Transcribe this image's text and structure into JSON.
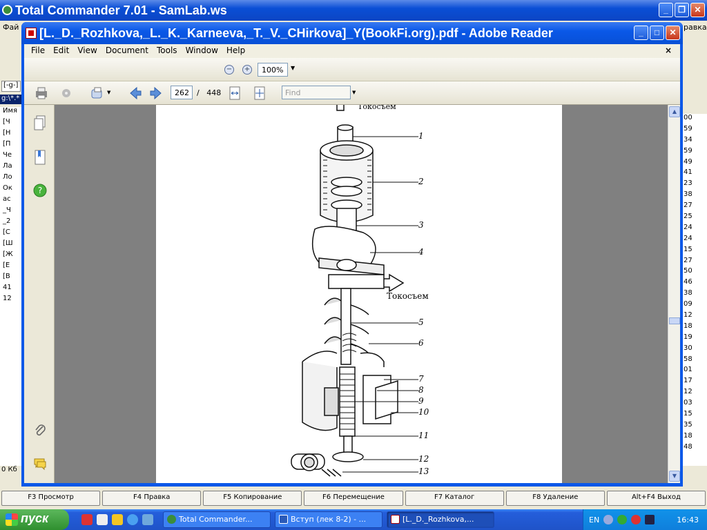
{
  "tc": {
    "title": "Total Commander 7.01 - SamLab.ws",
    "menu": "Фай",
    "menu_right": "равка",
    "left_items": [
      "Имя",
      "[Ч",
      "[Н",
      "[П",
      "Че",
      "Ла",
      "Ло",
      "Ок",
      "ас",
      "_Ч",
      "_2",
      "[С",
      "[Ш",
      "[Ж",
      "[Е",
      "[В",
      "41",
      "12"
    ],
    "right_items": [
      "00",
      "59",
      "34",
      "59",
      "49",
      "41",
      "23",
      "38",
      "27",
      "25",
      "24",
      "24",
      "15",
      "27",
      "50",
      "46",
      "38",
      "09",
      "12",
      "18",
      "19",
      "30",
      "58",
      "01",
      "17",
      "12",
      "03",
      "15",
      "35",
      "18",
      "48"
    ],
    "drive": "[-g-]",
    "path": "g:\\*.*",
    "status": "0 Кб",
    "fkeys": [
      "F3 Просмотр",
      "F4 Правка",
      "F5 Копирование",
      "F6 Перемещение",
      "F7 Каталог",
      "F8 Удаление",
      "Alt+F4 Выход"
    ]
  },
  "reader": {
    "title": "[L._D._Rozhkova,_L._K._Karneeva,_T._V._CHirkova]_Y(BookFi.org).pdf - Adobe Reader",
    "menu": [
      "File",
      "Edit",
      "View",
      "Document",
      "Tools",
      "Window",
      "Help"
    ],
    "zoom": "100%",
    "page_current": "262",
    "page_separator": "/",
    "page_total": "448",
    "find_placeholder": "Find"
  },
  "figure": {
    "top_label": "Токосъем",
    "mid_label": "Токосъем",
    "labels": [
      "1",
      "2",
      "3",
      "4",
      "5",
      "6",
      "7",
      "8",
      "9",
      "10",
      "11",
      "12",
      "13"
    ]
  },
  "taskbar": {
    "start": "пуск",
    "tasks": [
      "Total Commander...",
      "Вступ (лек 8-2) - ...",
      "[L._D._Rozhkova,..."
    ],
    "lang": "EN",
    "clock": "16:43"
  }
}
